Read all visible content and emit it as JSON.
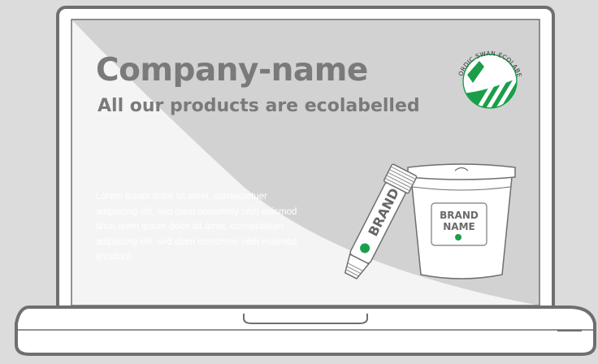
{
  "headline": "Company-name",
  "subheadline": "All our products are ecolabelled",
  "body_text": "Lorem ipsum dolor sit amet, consectetuer adipiscing elit, sed diam nonummy nibh euismod tinciLorem ipsum dolor sit amet, consectetuer adipiscing elit, sed diam nonummy nibh euismod tincidunt",
  "ecolabel": {
    "text": "NORDIC SWAN ECOLABEL",
    "color": "#1a9e4a"
  },
  "tube": {
    "brand": "BRAND"
  },
  "bucket": {
    "label_line1": "BRAND",
    "label_line2": "NAME"
  },
  "colors": {
    "frame": "#6f6f6f",
    "screen_shade": "#d2d2d2",
    "screen_light": "#f4f4f4",
    "background": "#dcdcdc",
    "headline": "#7a7a7a"
  }
}
